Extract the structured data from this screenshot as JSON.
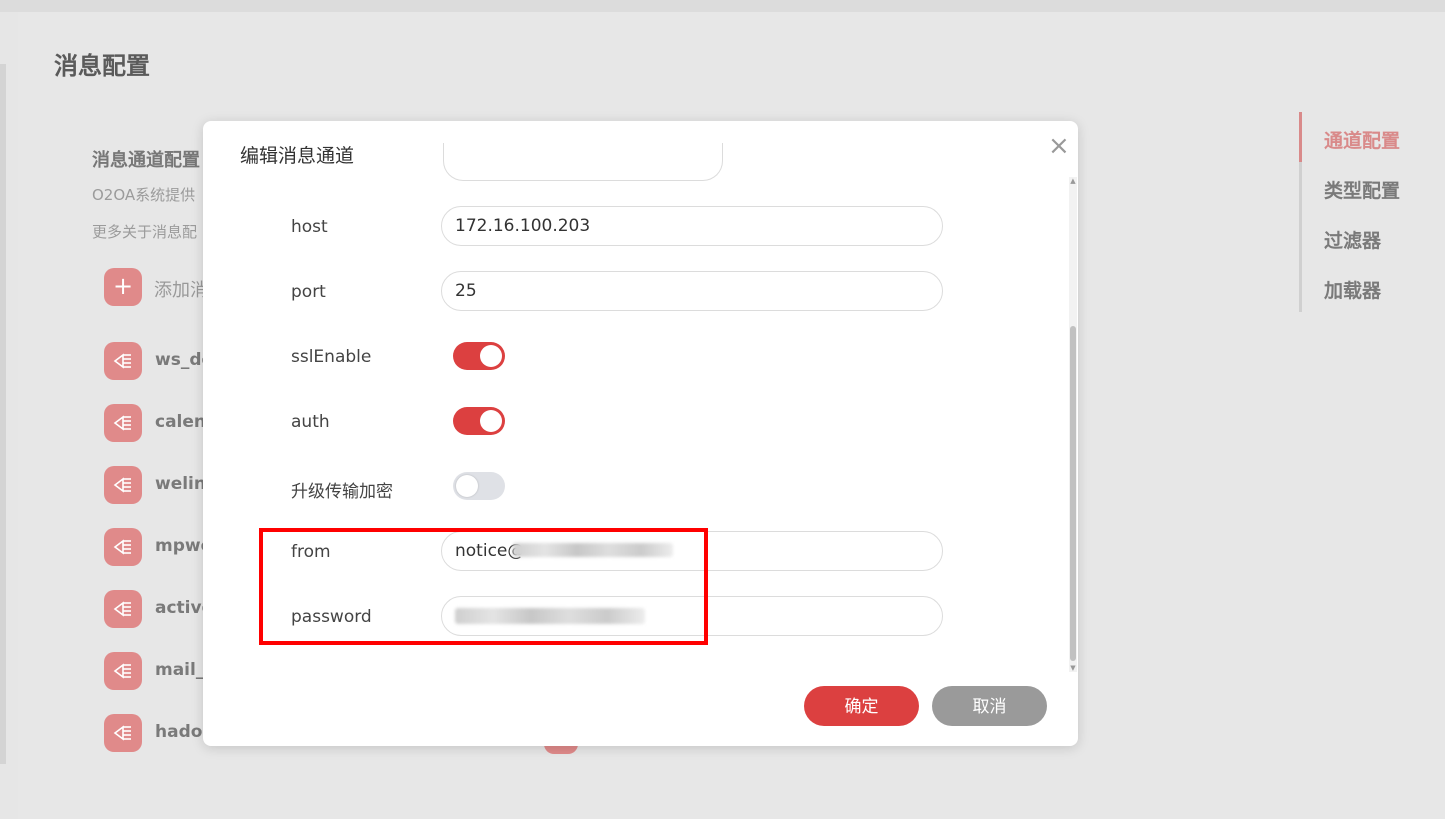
{
  "page": {
    "title": "消息配置",
    "section_title": "消息通道配置",
    "desc_line1": "O2OA系统提供",
    "desc_line2": "更多关于消息配",
    "add_label": "添加消",
    "channels": [
      "ws_de",
      "calenc",
      "welinl",
      "mpwe",
      "active",
      "mail_c",
      "hadoo"
    ]
  },
  "right_nav": {
    "items": [
      "通道配置",
      "类型配置",
      "过滤器",
      "加载器"
    ],
    "active": "通道配置"
  },
  "dialog": {
    "title": "编辑消息通道",
    "fields": {
      "host_label": "host",
      "host_value": "172.16.100.203",
      "port_label": "port",
      "port_value": "25",
      "ssl_label": "sslEnable",
      "ssl_on": true,
      "auth_label": "auth",
      "auth_on": true,
      "starttls_label": "升级传输加密",
      "starttls_on": false,
      "from_label": "from",
      "from_value": "notice@",
      "password_label": "password"
    },
    "ok_label": "确定",
    "cancel_label": "取消"
  },
  "colors": {
    "accent": "#dc4040",
    "nav_active": "#d98a8a",
    "icon_bg": "#e08a8a",
    "highlight": "#ff0000"
  },
  "icons": {
    "close": "close-icon",
    "add": "plus-icon",
    "channel": "channel-icon"
  }
}
